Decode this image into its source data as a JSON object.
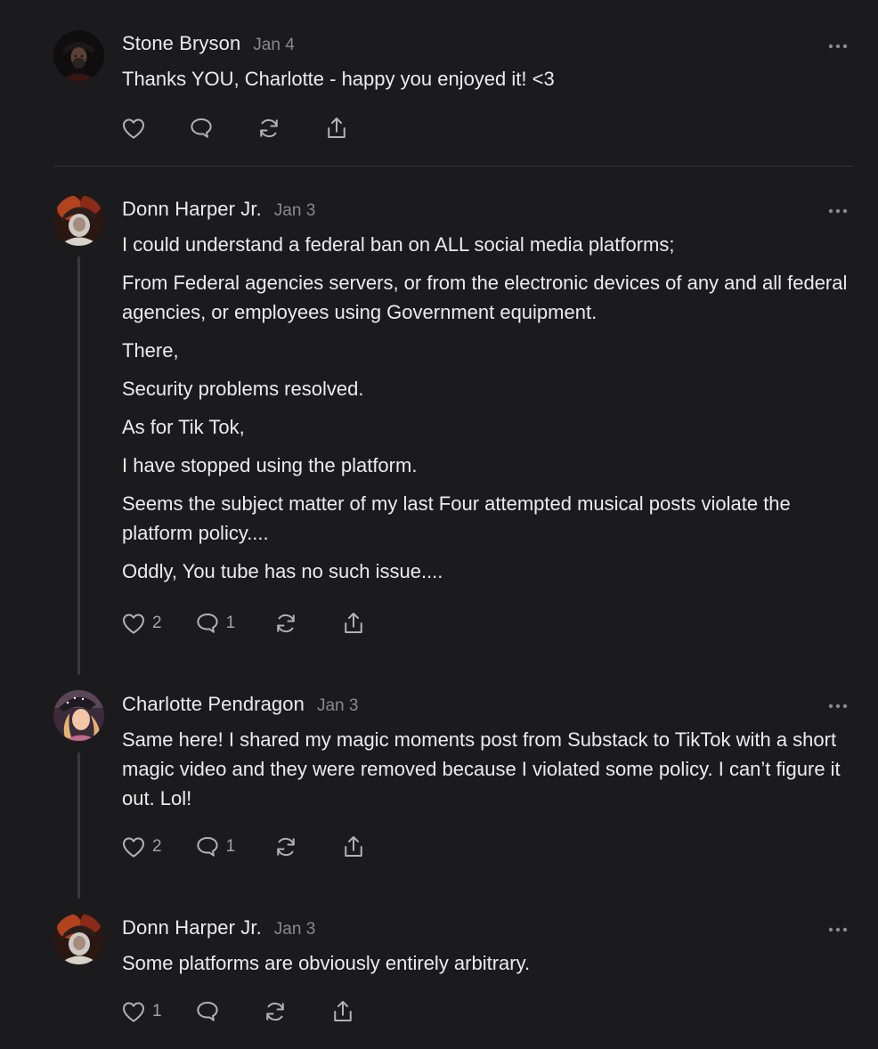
{
  "comments": [
    {
      "author": "Stone Bryson",
      "date": "Jan 4",
      "paragraphs": [
        "Thanks YOU, Charlotte - happy you enjoyed it! <3"
      ],
      "likes": "",
      "replies": "",
      "avatar": "stone-bryson-avatar"
    },
    {
      "author": "Donn Harper Jr.",
      "date": "Jan 3",
      "paragraphs": [
        "I could understand a federal ban on ALL social media platforms;",
        "From Federal agencies servers, or from the electronic devices of any and all federal agencies, or employees using Government equipment.",
        "There,",
        "Security problems resolved.",
        "As for Tik Tok,",
        "I have stopped using the platform.",
        "Seems the subject matter of my last Four attempted musical posts violate the platform policy....",
        "Oddly, You tube has no such issue...."
      ],
      "likes": "2",
      "replies": "1",
      "avatar": "donn-harper-avatar"
    },
    {
      "author": "Charlotte Pendragon",
      "date": "Jan 3",
      "paragraphs": [
        "Same here! I shared my magic moments post from Substack to TikTok with a short magic video and they were removed because I violated some policy. I can’t figure it out. Lol!"
      ],
      "likes": "2",
      "replies": "1",
      "avatar": "charlotte-pendragon-avatar"
    },
    {
      "author": "Donn Harper Jr.",
      "date": "Jan 3",
      "paragraphs": [
        "Some platforms are obviously entirely arbitrary."
      ],
      "likes": "1",
      "replies": "",
      "avatar": "donn-harper-avatar"
    }
  ],
  "icons": {
    "like": "heart-icon",
    "reply": "speech-bubble-icon",
    "restack": "restack-icon",
    "share": "share-icon",
    "more": "more-dots-icon"
  },
  "colors": {
    "background": "#1b1b1d",
    "text": "#ececec",
    "muted": "#8a8a8e",
    "icon": "#b3b3b7",
    "thread_line": "#3a3a3d"
  }
}
